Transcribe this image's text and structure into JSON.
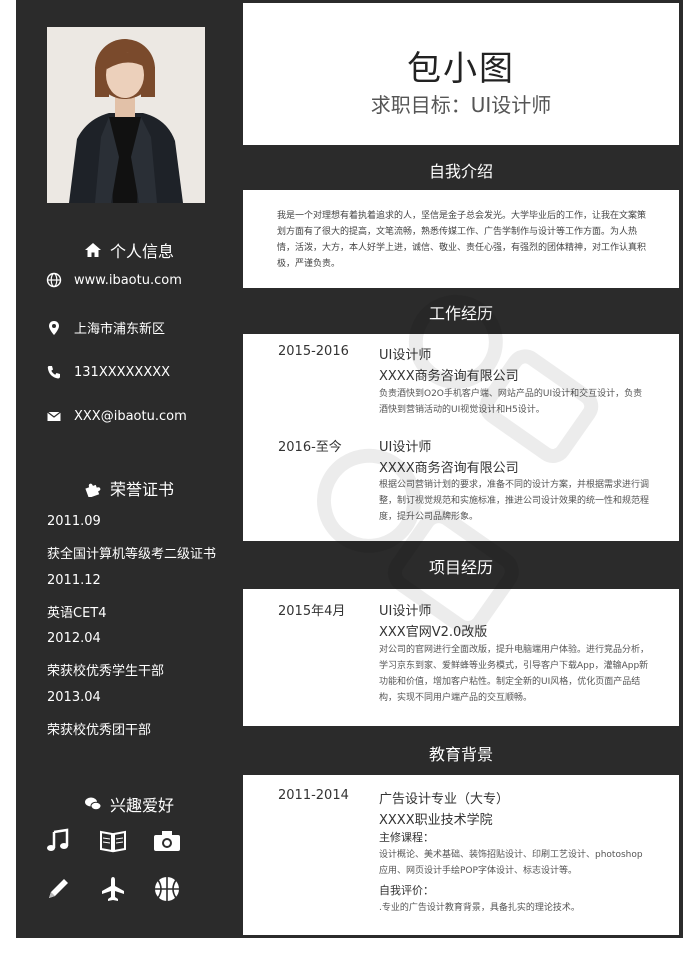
{
  "header": {
    "name": "包小图",
    "target": "求职目标：UI设计师"
  },
  "sidebar": {
    "personal_title": "个人信息",
    "contacts": [
      {
        "icon": "globe-icon",
        "text": "www.ibaotu.com"
      },
      {
        "icon": "location-pin-icon",
        "text": "上海市浦东新区"
      },
      {
        "icon": "phone-icon",
        "text": "131XXXXXXXX"
      },
      {
        "icon": "mail-icon",
        "text": "XXX@ibaotu.com"
      }
    ],
    "honor_title": "荣誉证书",
    "honors": [
      "2011.09",
      "获全国计算机等级考二级证书",
      "2011.12",
      "英语CET4",
      "2012.04",
      "荣获校优秀学生干部",
      "2013.04",
      "荣获校优秀团干部"
    ],
    "hobby_title": "兴趣爱好",
    "hobbies": [
      "music-icon",
      "book-icon",
      "camera-icon",
      "pencil-icon",
      "airplane-icon",
      "basketball-icon"
    ]
  },
  "sections": {
    "intro": {
      "title": "自我介绍",
      "text": "我是一个对理想有着执着追求的人，坚信是金子总会发光。大学毕业后的工作，让我在文案策划方面有了很大的提高，文笔流畅，熟悉传媒工作、广告学制作与设计等工作方面。为人热情，活泼，大方，本人好学上进，诚信、敬业、责任心强，有强烈的团体精神，对工作认真积极，严谨负责。"
    },
    "work": {
      "title": "工作经历",
      "items": [
        {
          "date": "2015-2016",
          "role": "UI设计师",
          "org": "XXXX商务咨询有限公司",
          "desc": "负责酒快到O2O手机客户端、网站产品的UI设计和交互设计，负责酒快到营销活动的UI视觉设计和H5设计。"
        },
        {
          "date": "2016-至今",
          "role": "UI设计师",
          "org": "XXXX商务咨询有限公司",
          "desc": "根据公司营销计划的要求，准备不同的设计方案，并根据需求进行调整，制订视觉规范和实施标准，推进公司设计效果的统一性和规范程度，提升公司品牌形象。"
        }
      ]
    },
    "project": {
      "title": "项目经历",
      "items": [
        {
          "date": "2015年4月",
          "role": "UI设计师",
          "org": "XXX官网V2.0改版",
          "desc": "对公司的官网进行全面改版，提升电脑端用户体验。进行竞品分析，学习京东到家、爱鲜蜂等业务模式，引导客户下载App，灌输App新功能和价值，增加客户粘性。制定全新的UI风格，优化页面产品结构，实现不同用户端产品的交互顺畅。"
        }
      ]
    },
    "education": {
      "title": "教育背景",
      "date": "2011-2014",
      "major": "广告设计专业（大专）",
      "school": "XXXX职业技术学院",
      "courses_label": "主修课程：",
      "courses": "设计概论、美术基础、装饰招贴设计、印刷工艺设计、photoshop应用、网页设计手绘POP字体设计、标志设计等。",
      "eval_label": "自我评价：",
      "eval": ".专业的广告设计教育背景，具备扎实的理论技术。"
    }
  }
}
